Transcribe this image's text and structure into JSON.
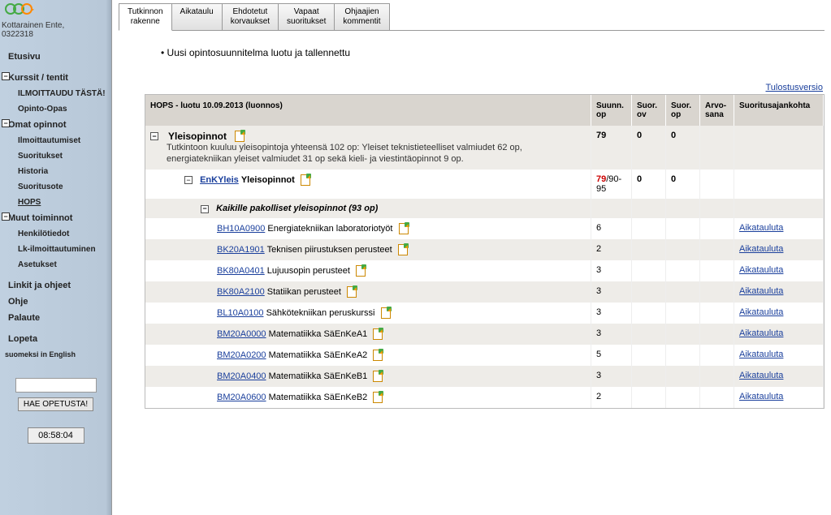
{
  "user": {
    "name": "Kottarainen Ente,",
    "id": "0322318"
  },
  "sidebar": {
    "home": "Etusivu",
    "courses": "Kurssit / tentit",
    "register": "ILMOITTAUDU TÄSTÄ!",
    "guide": "Opinto-Opas",
    "ownstudies": "Omat opinnot",
    "enrollments": "Ilmoittautumiset",
    "completions": "Suoritukset",
    "history": "Historia",
    "extract": "Suoritusote",
    "hops": "HOPS",
    "other": "Muut toiminnot",
    "personal": "Henkilötiedot",
    "ay": "Lk-ilmoittautuminen",
    "settings": "Asetukset",
    "links": "Linkit ja ohjeet",
    "help": "Ohje",
    "feedback": "Palaute",
    "logout": "Lopeta",
    "lang": "suomeksi  in English",
    "searchbtn": "HAE OPETUSTA!",
    "clock": "08:58:04"
  },
  "tabs": [
    {
      "l1": "Tutkinnon",
      "l2": "rakenne"
    },
    {
      "l1": "Aikataulu",
      "l2": ""
    },
    {
      "l1": "Ehdotetut",
      "l2": "korvaukset"
    },
    {
      "l1": "Vapaat",
      "l2": "suoritukset"
    },
    {
      "l1": "Ohjaajien",
      "l2": "kommentit"
    }
  ],
  "message": "Uusi opintosuunnitelma luotu ja tallennettu",
  "printlink": "Tulostusversio",
  "table": {
    "header_title": "HOPS - luotu 10.09.2013 (luonnos)",
    "h_suunn": "Suunn. op",
    "h_suorov": "Suor. ov",
    "h_suorop": "Suor. op",
    "h_arvo": "Arvo-sana",
    "h_ajank": "Suoritusajankohta"
  },
  "group1": {
    "title": "Yleisopinnot",
    "desc": "Tutkintoon kuuluu yleisopintoja yhteensä 102 op: Yleiset teknistieteelliset valmiudet 62 op, energiatekniikan yleiset valmiudet 31 op sekä kieli- ja viestintäopinnot 9 op.",
    "suunn": "79",
    "ov": "0",
    "op": "0"
  },
  "group2": {
    "code": "EnKYleis",
    "title": "Yleisopinnot",
    "suunn": "79",
    "range": "/90-95",
    "ov": "0",
    "op": "0"
  },
  "group3": {
    "title": "Kaikille pakolliset yleisopinnot (93 op)"
  },
  "courses": [
    {
      "code": "BH10A0900",
      "name": "Energiatekniikan laboratoriotyöt",
      "op": "6"
    },
    {
      "code": "BK20A1901",
      "name": "Teknisen piirustuksen perusteet",
      "op": "2"
    },
    {
      "code": "BK80A0401",
      "name": "Lujuusopin perusteet",
      "op": "3"
    },
    {
      "code": "BK80A2100",
      "name": "Statiikan perusteet",
      "op": "3"
    },
    {
      "code": "BL10A0100",
      "name": "Sähkötekniikan peruskurssi",
      "op": "3"
    },
    {
      "code": "BM20A0000",
      "name": "Matematiikka SäEnKeA1",
      "op": "3"
    },
    {
      "code": "BM20A0200",
      "name": "Matematiikka SäEnKeA2",
      "op": "5"
    },
    {
      "code": "BM20A0400",
      "name": "Matematiikka SäEnKeB1",
      "op": "3"
    },
    {
      "code": "BM20A0600",
      "name": "Matematiikka SäEnKeB2",
      "op": "2"
    }
  ],
  "schedule_label": "Aikatauluta"
}
